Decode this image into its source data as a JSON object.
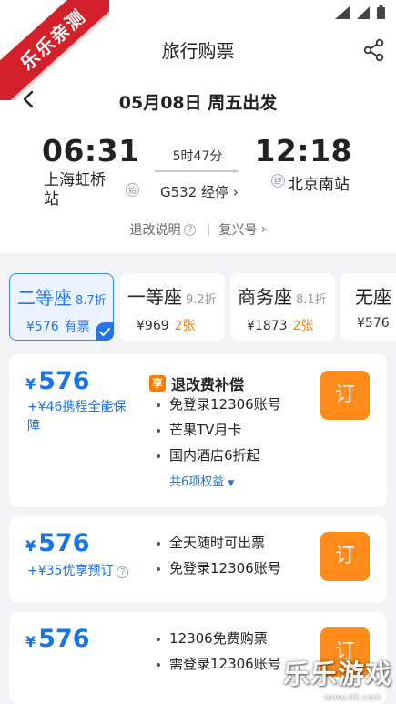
{
  "watermark": {
    "ribbon": "乐乐亲测",
    "logo": "乐乐游戏",
    "url": "www.6ll.com"
  },
  "header": {
    "title": "旅行购票"
  },
  "date_bar": {
    "date": "05月08日 周五出发"
  },
  "train": {
    "departure_time": "06:31",
    "departure_station": "上海虹桥站",
    "departure_tag": "始",
    "arrival_time": "12:18",
    "arrival_station": "北京南站",
    "arrival_tag": "终",
    "duration": "5时47分",
    "train_number": "G532 经停",
    "policy_label": "退改说明",
    "train_type": "复兴号"
  },
  "seats": [
    {
      "name": "二等座",
      "discount": "8.7折",
      "price": "¥576",
      "availability": "有票",
      "selected": true
    },
    {
      "name": "一等座",
      "discount": "9.2折",
      "price": "¥969",
      "availability": "2张",
      "selected": false
    },
    {
      "name": "商务座",
      "discount": "8.1折",
      "price": "¥1873",
      "availability": "2张",
      "selected": false
    },
    {
      "name": "无座",
      "discount": "",
      "price": "¥576",
      "availability": "",
      "selected": false
    }
  ],
  "options": [
    {
      "currency": "¥",
      "price": "576",
      "addon": "+¥46携程全能保障",
      "benefit_badge": "享",
      "benefit_title": "退改费补偿",
      "benefits": [
        "免登录12306账号",
        "芒果TV月卡",
        "国内酒店6折起"
      ],
      "more": "共6项权益",
      "order_label": "订"
    },
    {
      "currency": "¥",
      "price": "576",
      "addon": "+¥35优享预订",
      "benefits": [
        "全天随时可出票",
        "免登录12306账号"
      ],
      "order_label": "订"
    },
    {
      "currency": "¥",
      "price": "576",
      "benefits": [
        "12306免费购票",
        "需登录12306账号"
      ],
      "order_label": "订"
    }
  ],
  "colors": {
    "accent": "#1a73e8",
    "order_button": "#ff8c1a",
    "ribbon": "#d4202a"
  }
}
